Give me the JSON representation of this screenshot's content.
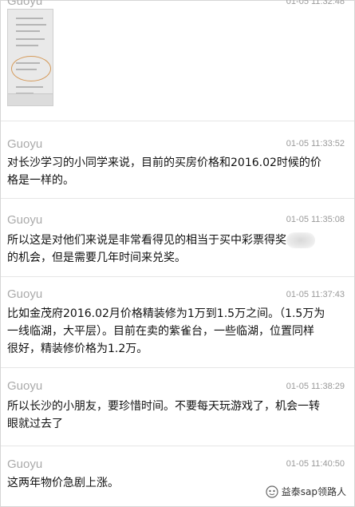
{
  "messages": [
    {
      "sender": "Guoyu",
      "time": "01-05 11:32:48",
      "type": "image"
    },
    {
      "sender": "Guoyu",
      "time": "01-05 11:33:52",
      "line1": "对长沙学习的小同学来说，目前的买房价格和2016.02时候的价",
      "line2": "格是一样的。"
    },
    {
      "sender": "Guoyu",
      "time": "01-05 11:35:08",
      "line1": "所以这是对他们来说是非常看得见的相当于买中彩票得奖",
      "line2": "的机会，但是需要几年时间来兑奖。"
    },
    {
      "sender": "Guoyu",
      "time": "01-05 11:37:43",
      "line1": "比如金茂府2016.02月价格精装修为1万到1.5万之间。（1.5万为",
      "line2": "一线临湖，大平层）。目前在卖的紫雀台，一些临湖，位置同样",
      "line3": "很好，精装修价格为1.2万。"
    },
    {
      "sender": "Guoyu",
      "time": "01-05 11:38:29",
      "line1": "所以长沙的小朋友，要珍惜时间。不要每天玩游戏了，机会一转",
      "line2": "眼就过去了"
    },
    {
      "sender": "Guoyu",
      "time": "01-05 11:40:50",
      "line1": "这两年物价急剧上涨。"
    }
  ],
  "watermark": {
    "icon": "wechat-official-account-icon",
    "text": "益泰sap领路人"
  }
}
